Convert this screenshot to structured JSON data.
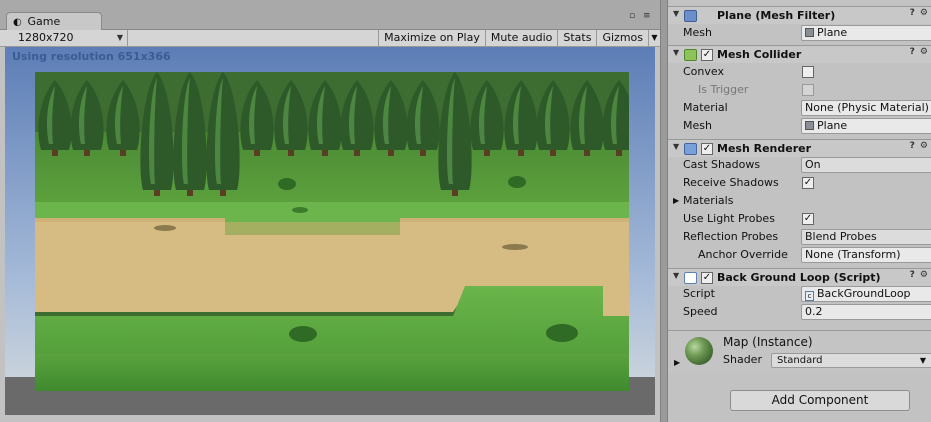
{
  "game": {
    "tab_label": "Game",
    "resolution": "1280x720",
    "toolbar": [
      "Maximize on Play",
      "Mute audio",
      "Stats",
      "Gizmos"
    ],
    "using_resolution": "Using resolution 651x366"
  },
  "inspector": {
    "mesh_filter": {
      "title": "Plane (Mesh Filter)",
      "mesh_label": "Mesh",
      "mesh_value": "Plane"
    },
    "mesh_collider": {
      "title": "Mesh Collider",
      "enabled": true,
      "convex_label": "Convex",
      "convex": false,
      "is_trigger_label": "Is Trigger",
      "is_trigger": false,
      "material_label": "Material",
      "material_value": "None (Physic Material)",
      "mesh_label": "Mesh",
      "mesh_value": "Plane"
    },
    "mesh_renderer": {
      "title": "Mesh Renderer",
      "enabled": true,
      "cast_shadows_label": "Cast Shadows",
      "cast_shadows_value": "On",
      "receive_shadows_label": "Receive Shadows",
      "receive_shadows": true,
      "materials_label": "Materials",
      "use_light_probes_label": "Use Light Probes",
      "use_light_probes": true,
      "reflection_probes_label": "Reflection Probes",
      "reflection_probes_value": "Blend Probes",
      "anchor_override_label": "Anchor Override",
      "anchor_override_value": "None (Transform)"
    },
    "script_comp": {
      "title": "Back Ground Loop (Script)",
      "enabled": true,
      "script_label": "Script",
      "script_value": "BackGroundLoop",
      "speed_label": "Speed",
      "speed_value": "0.2"
    },
    "material": {
      "name": "Map (Instance)",
      "shader_label": "Shader",
      "shader_value": "Standard"
    },
    "add_component_label": "Add Component"
  },
  "colors": {
    "mesh_filter_icon": "#6b8fc9",
    "mesh_collider_icon": "#8ec25a",
    "mesh_renderer_icon": "#7aa0d8",
    "script_icon": "#5b83b8",
    "grass": "#5a9e3a",
    "path": "#d8bd86",
    "tree": "#2e5a2a"
  }
}
